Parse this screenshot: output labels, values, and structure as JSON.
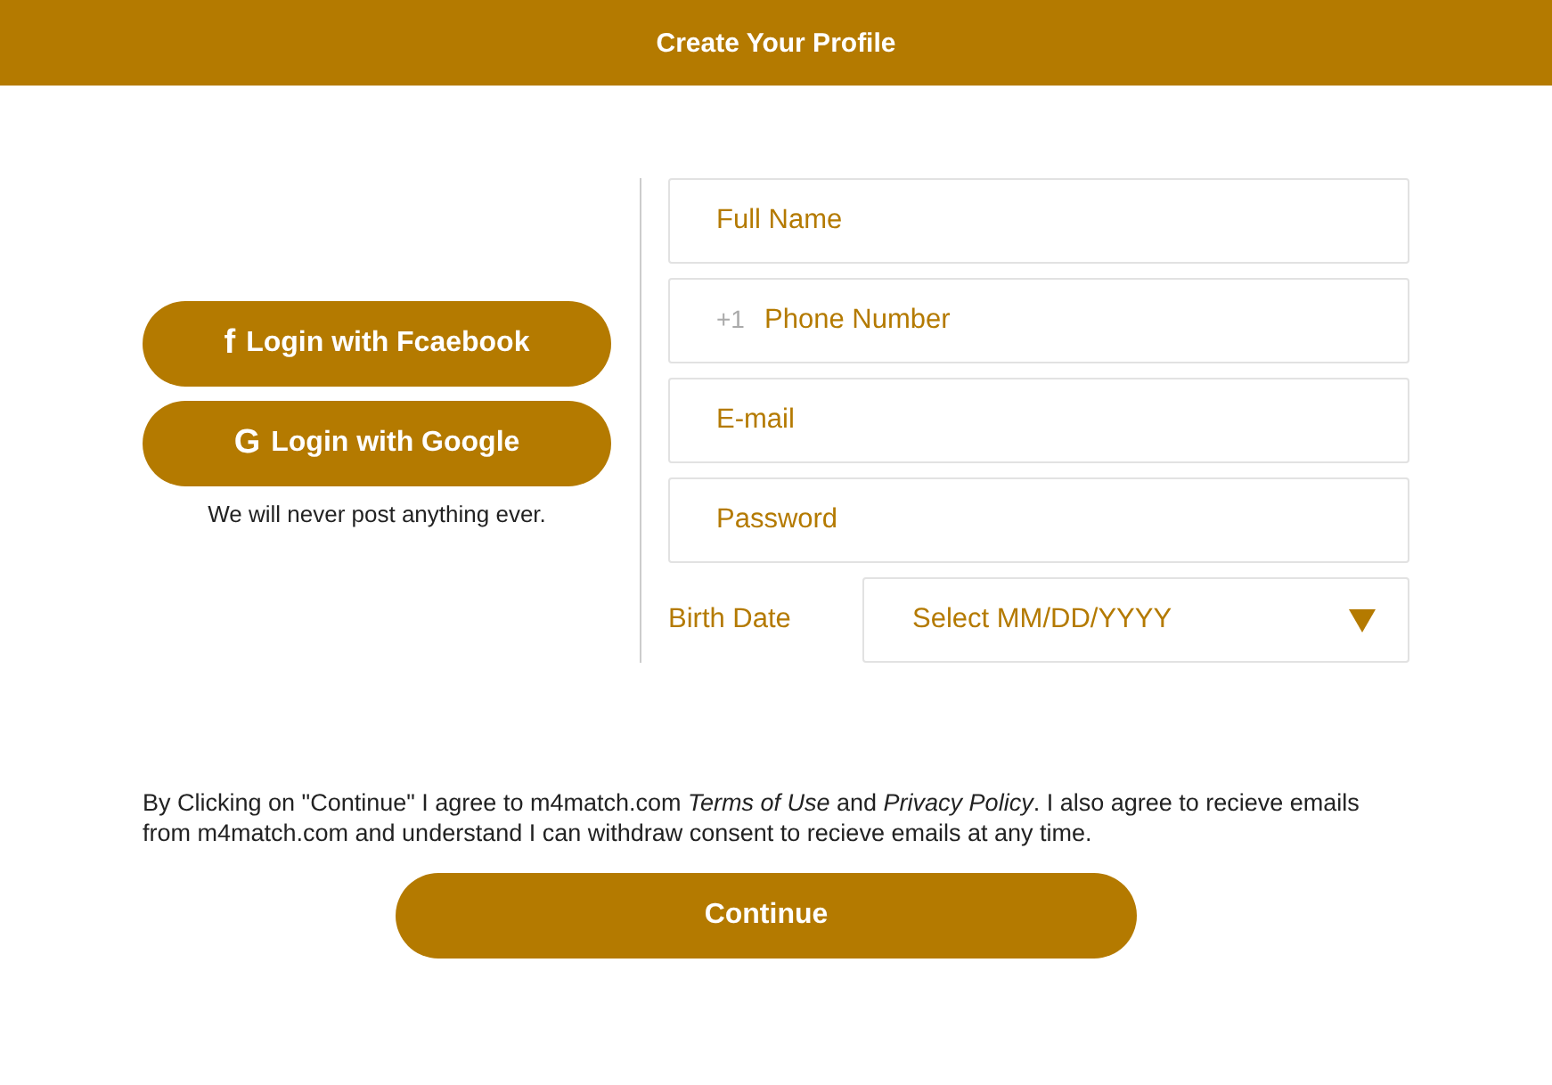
{
  "header": {
    "title": "Create Your Profile"
  },
  "social": {
    "buttons": [
      {
        "icon": "f",
        "label": "Login with Fcaebook"
      },
      {
        "icon": "G",
        "label": "Login with Google"
      }
    ],
    "note": "We will never post anything ever."
  },
  "fields": [
    {
      "kind": "text",
      "placeholder": "Full Name"
    },
    {
      "kind": "phone",
      "prefix": "+1",
      "placeholder": "Phone Number"
    },
    {
      "kind": "text",
      "placeholder": "E-mail"
    },
    {
      "kind": "password",
      "placeholder": "Password"
    }
  ],
  "birth_date": {
    "label": "Birth Date",
    "placeholder": "Select MM/DD/YYYY"
  },
  "consent": [
    {
      "kind": "text",
      "text": "By Clicking on \"Continue\" I agree to m4match.com "
    },
    {
      "kind": "link",
      "text": "Terms of Use"
    },
    {
      "kind": "text",
      "text": " and "
    },
    {
      "kind": "link",
      "text": "Privacy Policy"
    },
    {
      "kind": "text",
      "text": ". I also agree to recieve emails from m4match.com and understand I can withdraw consent to recieve emails at any time."
    }
  ],
  "continue_button": "Continue"
}
